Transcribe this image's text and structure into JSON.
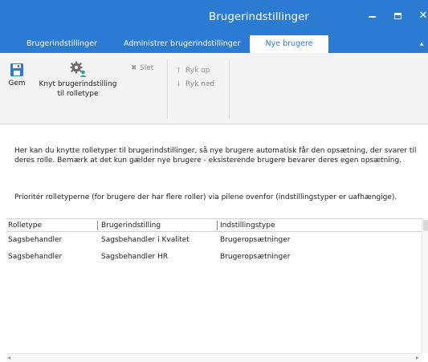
{
  "window": {
    "title": "Brugerindstillinger",
    "controls": {
      "minimize": "minimize",
      "maximize": "maximize",
      "close": "✕"
    }
  },
  "tabs": [
    {
      "label": "Brugerindstillinger",
      "active": false
    },
    {
      "label": "Administrer brugerindstillinger",
      "active": false
    },
    {
      "label": "Nye brugere",
      "active": true
    }
  ],
  "ribbon": {
    "save_label": "Gem",
    "link_label_line1": "Knyt brugerindstilling",
    "link_label_line2": "til rolletype",
    "delete_label": "Slet",
    "move_up_label": "Ryk op",
    "move_down_label": "Ryk ned"
  },
  "info": {
    "paragraph1": "Her kan du knytte rolletyper til brugerindstillinger, så nye brugere automatisk får den opsætning, der svarer til deres rolle. Bemærk at det kun gælder nye brugere - eksisterende brugere bevarer deres egen opsætning.",
    "paragraph2": "Prioritér rolletyperne (for brugere der har flere roller) via pilene ovenfor (indstillingstyper er uafhængige)."
  },
  "table": {
    "columns": [
      "Rolletype",
      "Brugerindstilling",
      "Indstillingstype"
    ],
    "rows": [
      [
        "Sagsbehandler",
        "Sagsbehandler i Kvalitet",
        "Brugeropsætninger"
      ],
      [
        "Sagsbehandler",
        "Sagsbehandler HR",
        "Brugeropsætninger"
      ]
    ]
  },
  "colors": {
    "accent": "#2b7bd3",
    "ribbon_bg": "#f3f3f3",
    "disabled_text": "#8e8e8e"
  },
  "icons": {
    "save": "floppy-disk-icon",
    "link": "gear-user-icon",
    "delete": "cross-icon",
    "up": "arrow-up-icon",
    "down": "arrow-down-icon"
  }
}
